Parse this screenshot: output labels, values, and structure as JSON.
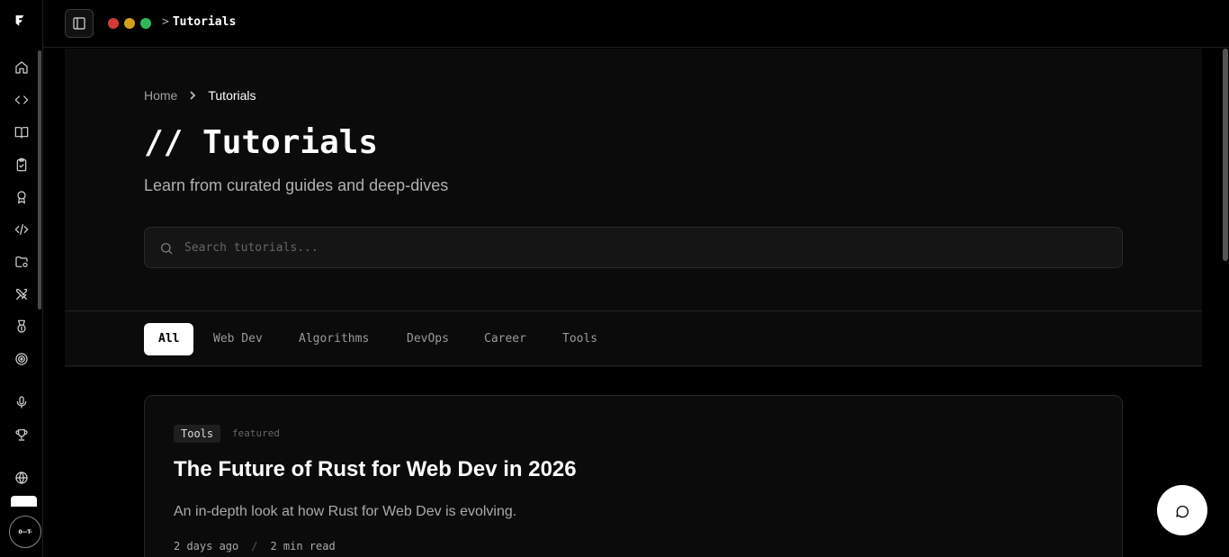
{
  "rail": {
    "items": [
      {
        "icon": "home-icon"
      },
      {
        "icon": "code-icon"
      },
      {
        "icon": "book-icon"
      },
      {
        "icon": "clipboard-check-icon"
      },
      {
        "icon": "award-icon"
      },
      {
        "icon": "code-slash-icon"
      },
      {
        "icon": "folder-settings-icon"
      },
      {
        "icon": "swords-icon"
      },
      {
        "icon": "medal-icon"
      },
      {
        "icon": "target-icon"
      },
      {
        "icon": "mic-icon"
      },
      {
        "icon": "trophy-icon"
      },
      {
        "icon": "globe-icon"
      }
    ],
    "avatar_text": "0—T-"
  },
  "topbar": {
    "breadcrumb_sep": ">",
    "breadcrumb": "Tutorials",
    "dot_colors": [
      "#d33a3a",
      "#d4a017",
      "#2fb85a"
    ]
  },
  "hero": {
    "breadcrumb": {
      "home": "Home",
      "current": "Tutorials"
    },
    "title": "// Tutorials",
    "subtitle": "Learn from curated guides and deep-dives",
    "search_placeholder": "Search tutorials..."
  },
  "filters": {
    "tabs": [
      "All",
      "Web Dev",
      "Algorithms",
      "DevOps",
      "Career",
      "Tools"
    ],
    "active": "All"
  },
  "featured_card": {
    "tag": "Tools",
    "badge": "featured",
    "title": "The Future of Rust for Web Dev in 2026",
    "description": "An in-depth look at how Rust for Web Dev is evolving.",
    "date": "2 days ago",
    "separator": "/",
    "read_time": "2 min read"
  },
  "chat": {
    "icon": "message-circle-icon"
  }
}
